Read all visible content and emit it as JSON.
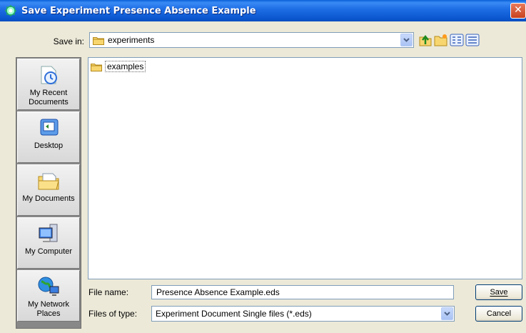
{
  "window": {
    "title": "Save Experiment Presence Absence Example",
    "close_glyph": "✕"
  },
  "save_in": {
    "label": "Save in:",
    "value": "experiments",
    "icon": "folder-icon"
  },
  "toolbar": {
    "icons": [
      "up-one-level-icon",
      "create-new-folder-icon",
      "list-view-icon",
      "details-view-icon"
    ]
  },
  "places": [
    {
      "label": "My Recent Documents",
      "icon": "recent-documents-icon"
    },
    {
      "label": "Desktop",
      "icon": "desktop-icon"
    },
    {
      "label": "My Documents",
      "icon": "my-documents-icon"
    },
    {
      "label": "My Computer",
      "icon": "my-computer-icon"
    },
    {
      "label": "My Network Places",
      "icon": "network-places-icon"
    }
  ],
  "files": [
    {
      "name": "examples",
      "icon": "folder-icon"
    }
  ],
  "file_name": {
    "label": "File name:",
    "value": "Presence Absence Example.eds"
  },
  "files_of_type": {
    "label": "Files of type:",
    "value": "Experiment Document Single files (*.eds)"
  },
  "buttons": {
    "save": "Save",
    "cancel": "Cancel"
  },
  "colors": {
    "titlebar": "#0b57d0",
    "dialog_bg": "#ece9d8",
    "field_border": "#7f9db9"
  }
}
